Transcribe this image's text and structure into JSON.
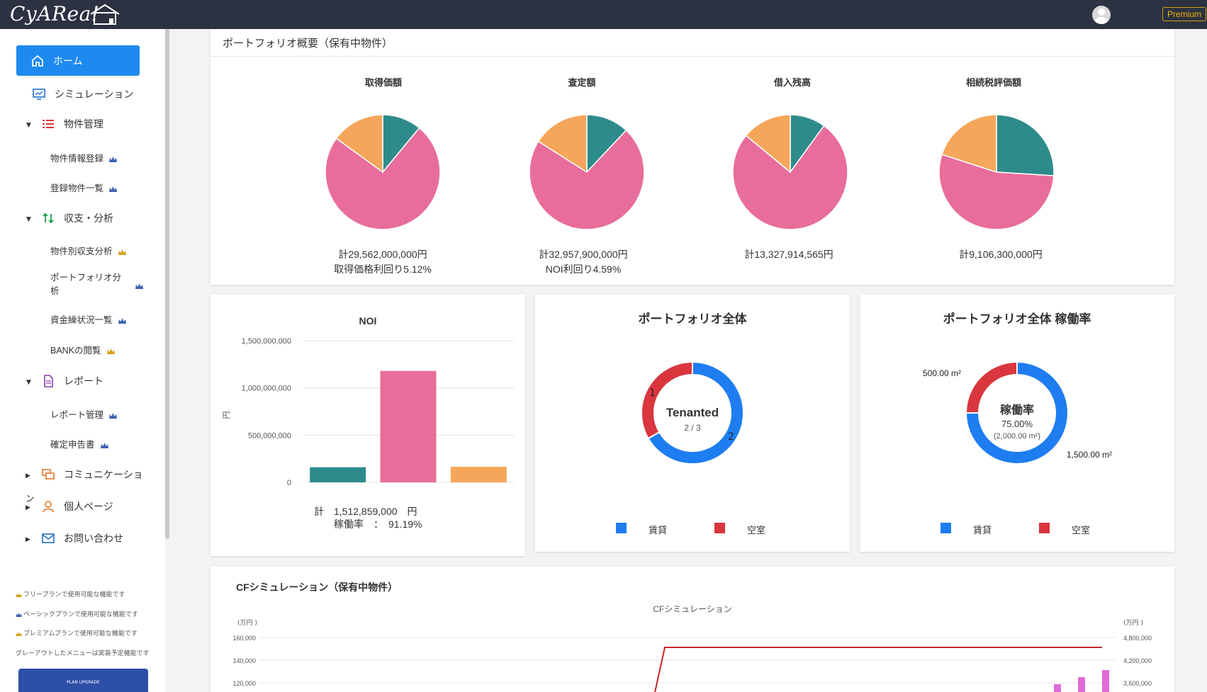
{
  "header": {
    "logo_text": "CyARea!",
    "logo_house_text": "Real Estate",
    "premium_label": "Premium"
  },
  "sidebar": {
    "home": "ホーム",
    "simulation": "シミュレーション",
    "property_mgmt": "物件管理",
    "property_register": "物件情報登録",
    "property_list": "登録物件一覧",
    "income_analysis": "収支・分析",
    "per_property_analysis": "物件別収支分析",
    "portfolio_analysis_1": "ポートフォリオ分",
    "portfolio_analysis_2": "析",
    "funding_list": "資金繰状況一覧",
    "bank_view": "BANKの閲覧",
    "report": "レポート",
    "report_mgmt": "レポート管理",
    "tax_return": "確定申告書",
    "communication_1": "コミュニケーショ",
    "communication_2": "ン",
    "personal_page": "個人ページ",
    "contact": "お問い合わせ",
    "note_free": "フリープランで使用可能な機能です",
    "note_basic": "ベーシックプランで使用可能な機能です",
    "note_premium": "プレミアムプランで使用可能な機能です",
    "note_grey": "グレーアウトしたメニューは実装予定機能です",
    "upgrade_label": "PLAN UPGRADE"
  },
  "portfolio": {
    "title": "ポートフォリオ概要（保有中物件）",
    "pies": [
      {
        "title": "取得価額",
        "total": "計29,562,000,000円",
        "sub": "取得価格利回り5.12%"
      },
      {
        "title": "査定額",
        "total": "計32,957,900,000円",
        "sub": "NOI利回り4.59%"
      },
      {
        "title": "借入残高",
        "total": "計13,327,914,565円",
        "sub": ""
      },
      {
        "title": "相続税評価額",
        "total": "計9,106,300,000円",
        "sub": ""
      }
    ]
  },
  "noi": {
    "total_label": "計　1,512,859,000　円",
    "occupancy_label": "稼働率　：　91.19%"
  },
  "portfolio_all": {
    "title": "ポートフォリオ全体",
    "center_label": "Tenanted",
    "center_value": "2 / 3",
    "seg_label_1": "1",
    "seg_label_2": "2",
    "legend_rent": "賃貸",
    "legend_vacant": "空室"
  },
  "occupancy": {
    "title": "ポートフォリオ全体 稼働率",
    "center_label": "稼働率",
    "center_value": "75.00%",
    "center_sub": "(2,000.00 m²)",
    "vacant_area": "500.00 m²",
    "rent_area": "1,500.00 m²",
    "legend_rent": "賃貸",
    "legend_vacant": "空室"
  },
  "cf": {
    "title": "CFシミュレーション（保有中物件）",
    "chart_title": "CFシミュレーション",
    "left_unit": "(万円 )",
    "right_unit": "(万円 )"
  },
  "colors": {
    "teal": "#2e8b8b",
    "pink": "#e86d9b",
    "orange": "#f5a65b",
    "blue": "#1e7df0",
    "red": "#d9363e",
    "accent": "#1e8af0"
  },
  "chart_data": [
    {
      "type": "pie",
      "title": "取得価額",
      "labels": [],
      "values": [
        11,
        74,
        15
      ]
    },
    {
      "type": "pie",
      "title": "査定額",
      "labels": [],
      "values": [
        12,
        72,
        16
      ]
    },
    {
      "type": "pie",
      "title": "借入残高",
      "labels": [],
      "values": [
        10,
        76,
        14
      ]
    },
    {
      "type": "pie",
      "title": "相続税評価額",
      "labels": [],
      "values": [
        26,
        54,
        20
      ]
    },
    {
      "type": "bar",
      "title": "NOI",
      "categories": [
        "",
        "",
        ""
      ],
      "values": [
        160000000,
        1180000000,
        165000000
      ],
      "ylabel": "円",
      "ylim": [
        0,
        1500000000
      ],
      "yticks": [
        "0",
        "500,000,000",
        "1,000,000,000",
        "1,500,000,000"
      ]
    },
    {
      "type": "pie",
      "title": "ポートフォリオ全体",
      "labels": [
        "賃貸",
        "空室"
      ],
      "values": [
        2,
        1
      ]
    },
    {
      "type": "pie",
      "title": "ポートフォリオ全体 稼働率",
      "labels": [
        "賃貸",
        "空室"
      ],
      "values": [
        1500,
        500
      ]
    },
    {
      "type": "line",
      "title": "CFシミュレーション",
      "left_ticks": [
        "120,000",
        "140,000",
        "160,000"
      ],
      "right_ticks": [
        "3,600,000",
        "4,200,000",
        "4,800,000"
      ]
    }
  ]
}
